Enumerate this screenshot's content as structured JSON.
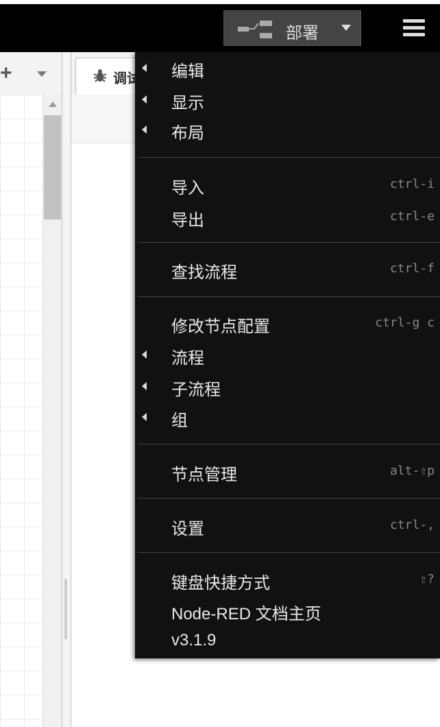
{
  "header": {
    "deploy_label": "部署",
    "colors": {
      "bar": "#000000",
      "deploy_bg": "#444444"
    }
  },
  "workspace": {
    "add_flow_icon": "plus-icon",
    "flow_list_icon": "caret-down-icon"
  },
  "sidebar": {
    "debug_tab_label": "调试",
    "debug_icon": "bug-icon"
  },
  "menu": {
    "items": [
      {
        "label": "编辑",
        "shortcut": "",
        "submenu": true
      },
      {
        "label": "显示",
        "shortcut": "",
        "submenu": true
      },
      {
        "label": "布局",
        "shortcut": "",
        "submenu": true
      },
      {
        "label": "导入",
        "shortcut": "ctrl-i",
        "submenu": false
      },
      {
        "label": "导出",
        "shortcut": "ctrl-e",
        "submenu": false
      },
      {
        "label": "查找流程",
        "shortcut": "ctrl-f",
        "submenu": false
      },
      {
        "label": "修改节点配置",
        "shortcut": "ctrl-g c",
        "submenu": false
      },
      {
        "label": "流程",
        "shortcut": "",
        "submenu": true
      },
      {
        "label": "子流程",
        "shortcut": "",
        "submenu": true
      },
      {
        "label": "组",
        "shortcut": "",
        "submenu": true
      },
      {
        "label": "节点管理",
        "shortcut": "alt-⇧p",
        "submenu": false
      },
      {
        "label": "设置",
        "shortcut": "ctrl-,",
        "submenu": false
      },
      {
        "label": "键盘快捷方式",
        "shortcut": "⇧?",
        "submenu": false
      },
      {
        "label": "Node-RED 文档主页",
        "shortcut": "",
        "submenu": false
      },
      {
        "label": "v3.1.9",
        "shortcut": "",
        "submenu": false
      }
    ]
  }
}
